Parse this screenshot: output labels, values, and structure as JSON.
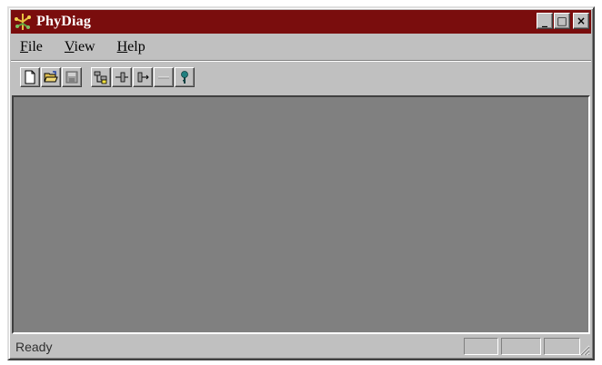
{
  "window": {
    "title": "PhyDiag",
    "controls": {
      "minimize": "_",
      "maximize": "□",
      "close": "×"
    },
    "title_bar_color": "#7a0d0d"
  },
  "menu": {
    "file": {
      "accel": "F",
      "rest": "ile"
    },
    "view": {
      "accel": "V",
      "rest": "iew"
    },
    "help": {
      "accel": "H",
      "rest": "elp"
    }
  },
  "toolbar": {
    "buttons": [
      "new-document-icon",
      "open-folder-icon",
      "save-disk-icon",
      "tree-layout-icon",
      "expand-icon",
      "collapse-icon",
      "disabled-icon",
      "help-icon"
    ]
  },
  "client_area": {
    "color": "#808080"
  },
  "status": {
    "text": "Ready"
  }
}
